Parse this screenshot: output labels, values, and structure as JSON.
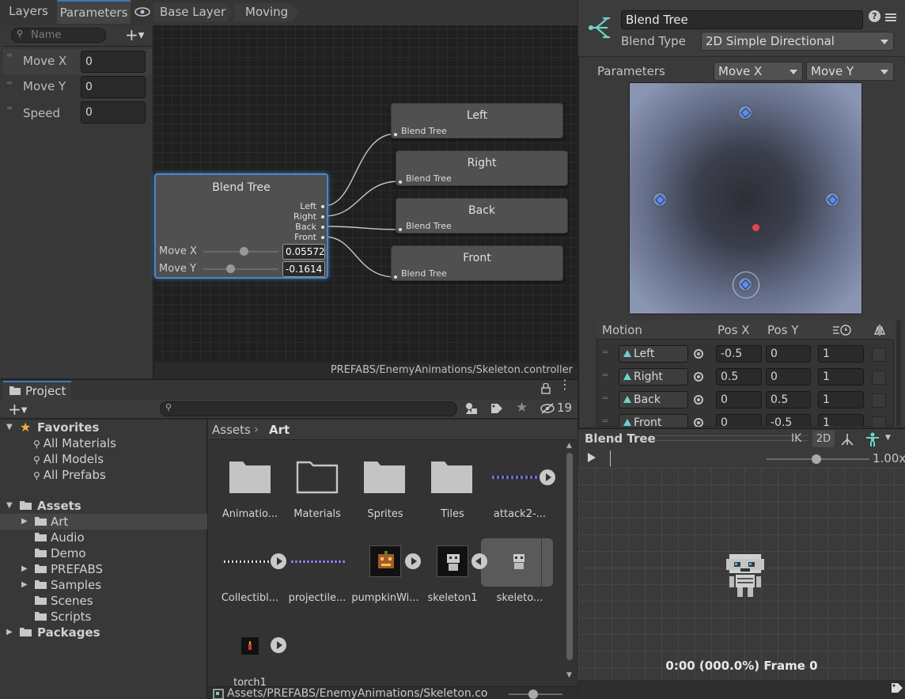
{
  "animator": {
    "tabs": {
      "layers": "Layers",
      "parameters": "Parameters"
    },
    "breadcrumb": [
      "Base Layer",
      "Moving"
    ],
    "search_placeholder": "Name",
    "params": [
      {
        "name": "Move X",
        "value": "0"
      },
      {
        "name": "Move Y",
        "value": "0"
      },
      {
        "name": "Speed",
        "value": "0"
      }
    ],
    "blend_node": {
      "title": "Blend Tree",
      "outputs": [
        "Left",
        "Right",
        "Back",
        "Front"
      ],
      "move_x_label": "Move X",
      "move_x_value": "0.05572",
      "move_y_label": "Move Y",
      "move_y_value": "-0.1614"
    },
    "child_nodes": [
      {
        "title": "Left",
        "sub": "Blend Tree"
      },
      {
        "title": "Right",
        "sub": "Blend Tree"
      },
      {
        "title": "Back",
        "sub": "Blend Tree"
      },
      {
        "title": "Front",
        "sub": "Blend Tree"
      }
    ],
    "path": "PREFABS/EnemyAnimations/Skeleton.controller"
  },
  "inspector": {
    "name": "Blend Tree",
    "blend_type_label": "Blend Type",
    "blend_type": "2D Simple Directional",
    "parameters_label": "Parameters",
    "param_x": "Move X",
    "param_y": "Move Y",
    "motion_headers": {
      "motion": "Motion",
      "posx": "Pos X",
      "posy": "Pos Y"
    },
    "motions": [
      {
        "name": "Left",
        "x": "-0.5",
        "y": "0",
        "speed": "1"
      },
      {
        "name": "Right",
        "x": "0.5",
        "y": "0",
        "speed": "1"
      },
      {
        "name": "Back",
        "x": "0",
        "y": "0.5",
        "speed": "1"
      },
      {
        "name": "Front",
        "x": "0",
        "y": "-0.5",
        "speed": "1"
      }
    ]
  },
  "preview": {
    "title": "Blend Tree",
    "ik": "IK",
    "mode": "2D",
    "speed": "1.00x",
    "time": "0:00 (000.0%) Frame 0"
  },
  "project": {
    "tab": "Project",
    "hidden_count": "19",
    "favorites_label": "Favorites",
    "favorites": [
      "All Materials",
      "All Models",
      "All Prefabs"
    ],
    "assets_label": "Assets",
    "assets": [
      "Art",
      "Audio",
      "Demo",
      "PREFABS",
      "Samples",
      "Scenes",
      "Scripts"
    ],
    "packages_label": "Packages",
    "crumb_root": "Assets",
    "crumb_current": "Art",
    "items": [
      "Animatio...",
      "Materials",
      "Sprites",
      "Tiles",
      "attack2-...",
      "Collectibl...",
      "projectile...",
      "pumpkinWi...",
      "skeleton1",
      "skeleto...",
      "torch1"
    ],
    "status_path": "Assets/PREFABS/EnemyAnimations/Skeleton.co"
  },
  "colors": {
    "accent": "#3a79bb",
    "panel": "#383838",
    "dark": "#282828"
  }
}
